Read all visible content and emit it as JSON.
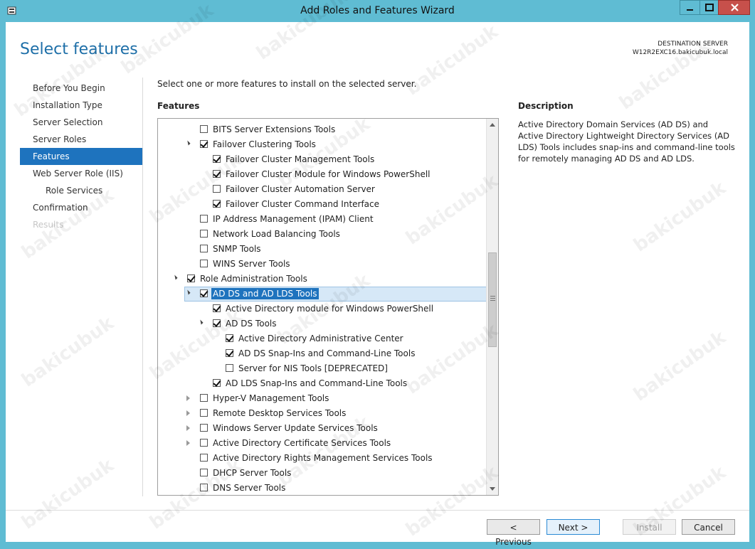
{
  "window": {
    "title": "Add Roles and Features Wizard",
    "controls": {
      "minimize": "–",
      "maximize": "□",
      "close": "✕"
    }
  },
  "header": {
    "page_title": "Select features",
    "destination_label": "DESTINATION SERVER",
    "destination_server": "W12R2EXC16.bakicubuk.local"
  },
  "nav": {
    "items": [
      {
        "label": "Before You Begin",
        "state": "normal"
      },
      {
        "label": "Installation Type",
        "state": "normal"
      },
      {
        "label": "Server Selection",
        "state": "normal"
      },
      {
        "label": "Server Roles",
        "state": "normal"
      },
      {
        "label": "Features",
        "state": "active"
      },
      {
        "label": "Web Server Role (IIS)",
        "state": "normal"
      },
      {
        "label": "Role Services",
        "state": "sub"
      },
      {
        "label": "Confirmation",
        "state": "normal"
      },
      {
        "label": "Results",
        "state": "disabled"
      }
    ]
  },
  "main": {
    "intro": "Select one or more features to install on the selected server.",
    "features_label": "Features",
    "description_label": "Description",
    "description_text": "Active Directory Domain Services (AD DS) and Active Directory Lightweight Directory Services (AD LDS) Tools includes snap-ins and command-line tools for remotely managing AD DS and AD LDS."
  },
  "tree": {
    "rows": [
      {
        "label": "BITS Server Extensions Tools",
        "level": 2,
        "expander": "none",
        "checked": false
      },
      {
        "label": "Failover Clustering Tools",
        "level": 2,
        "expander": "open",
        "checked": true
      },
      {
        "label": "Failover Cluster Management Tools",
        "level": 3,
        "expander": "none",
        "checked": true
      },
      {
        "label": "Failover Cluster Module for Windows PowerShell",
        "level": 3,
        "expander": "none",
        "checked": true
      },
      {
        "label": "Failover Cluster Automation Server",
        "level": 3,
        "expander": "none",
        "checked": false
      },
      {
        "label": "Failover Cluster Command Interface",
        "level": 3,
        "expander": "none",
        "checked": true
      },
      {
        "label": "IP Address Management (IPAM) Client",
        "level": 2,
        "expander": "none",
        "checked": false
      },
      {
        "label": "Network Load Balancing Tools",
        "level": 2,
        "expander": "none",
        "checked": false
      },
      {
        "label": "SNMP Tools",
        "level": 2,
        "expander": "none",
        "checked": false
      },
      {
        "label": "WINS Server Tools",
        "level": 2,
        "expander": "none",
        "checked": false
      },
      {
        "label": "Role Administration Tools",
        "level": 1,
        "expander": "open",
        "checked": true
      },
      {
        "label": "AD DS and AD LDS Tools",
        "level": 2,
        "expander": "open",
        "checked": true,
        "selected": true
      },
      {
        "label": "Active Directory module for Windows PowerShell",
        "level": 3,
        "expander": "none",
        "checked": true
      },
      {
        "label": "AD DS Tools",
        "level": 3,
        "expander": "open",
        "checked": true
      },
      {
        "label": "Active Directory Administrative Center",
        "level": 4,
        "expander": "none",
        "checked": true
      },
      {
        "label": "AD DS Snap-Ins and Command-Line Tools",
        "level": 4,
        "expander": "none",
        "checked": true
      },
      {
        "label": "Server for NIS Tools [DEPRECATED]",
        "level": 4,
        "expander": "none",
        "checked": false
      },
      {
        "label": "AD LDS Snap-Ins and Command-Line Tools",
        "level": 3,
        "expander": "none",
        "checked": true
      },
      {
        "label": "Hyper-V Management Tools",
        "level": 2,
        "expander": "closed",
        "checked": false
      },
      {
        "label": "Remote Desktop Services Tools",
        "level": 2,
        "expander": "closed",
        "checked": false
      },
      {
        "label": "Windows Server Update Services Tools",
        "level": 2,
        "expander": "closed",
        "checked": false
      },
      {
        "label": "Active Directory Certificate Services Tools",
        "level": 2,
        "expander": "closed",
        "checked": false
      },
      {
        "label": "Active Directory Rights Management Services Tools",
        "level": 2,
        "expander": "none",
        "checked": false
      },
      {
        "label": "DHCP Server Tools",
        "level": 2,
        "expander": "none",
        "checked": false
      },
      {
        "label": "DNS Server Tools",
        "level": 2,
        "expander": "none",
        "checked": false
      }
    ]
  },
  "footer": {
    "previous": "< Previous",
    "next": "Next >",
    "install": "Install",
    "cancel": "Cancel"
  },
  "watermark": "bakicubuk"
}
